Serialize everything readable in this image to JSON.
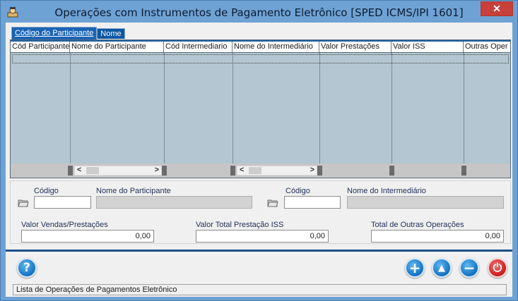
{
  "window": {
    "title": "Operações com Instrumentos de Pagamento Eletrônico [SPED ICMS/IPI 1601]",
    "close_glyph": "✕"
  },
  "tabs": [
    {
      "label": "Código do Participante",
      "active": true
    },
    {
      "label": "Nome",
      "active": false
    }
  ],
  "grid": {
    "columns": [
      "Cód Participante",
      "Nome do Participante",
      "Cód Intermediario",
      "Nome do Intermediário",
      "Valor Prestações",
      "Valor  ISS",
      "Outras Oper"
    ],
    "rows": []
  },
  "filters": {
    "codigo_participante_label": "Código",
    "codigo_participante_value": "",
    "nome_participante_label": "Nome do Participante",
    "nome_participante_value": "",
    "codigo_intermediario_label": "Código",
    "codigo_intermediario_value": "",
    "nome_intermediario_label": "Nome do Intermediário",
    "nome_intermediario_value": ""
  },
  "totals": {
    "vendas_label": "Valor Vendas/Prestações",
    "vendas_value": "0,00",
    "iss_label": "Valor Total Prestação ISS",
    "iss_value": "0,00",
    "outras_label": "Total de Outras Operações",
    "outras_value": "0,00"
  },
  "buttons": {
    "help": "?",
    "add": "+",
    "up": "▲",
    "remove": "−",
    "power": "⏻"
  },
  "icons": {
    "app": "app-user-icon",
    "folder": "folder-open-icon"
  },
  "status": {
    "text": "Lista de Operações de Pagamentos Eletrônico"
  }
}
